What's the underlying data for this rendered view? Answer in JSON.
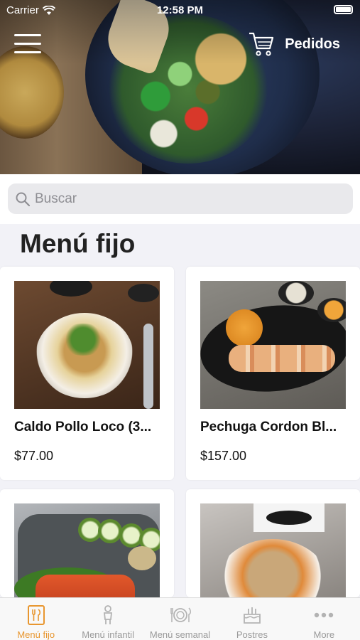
{
  "status_bar": {
    "carrier": "Carrier",
    "time": "12:58 PM"
  },
  "header": {
    "orders_label": "Pedidos"
  },
  "search": {
    "placeholder": "Buscar"
  },
  "section": {
    "title": "Menú fijo"
  },
  "products": [
    {
      "name": "Caldo Pollo Loco (3...",
      "price": "$77.00",
      "photo": "soup"
    },
    {
      "name": "Pechuga Cordon Bl...",
      "price": "$157.00",
      "photo": "chicken"
    },
    {
      "name": "",
      "price": "",
      "photo": "fish"
    },
    {
      "name": "",
      "price": "",
      "photo": "rice"
    }
  ],
  "tabs": [
    {
      "label": "Menú fijo",
      "icon": "menu-card-icon",
      "active": true
    },
    {
      "label": "Menú infantil",
      "icon": "child-icon",
      "active": false
    },
    {
      "label": "Menú semanal",
      "icon": "cutlery-plate-icon",
      "active": false
    },
    {
      "label": "Postres",
      "icon": "cake-icon",
      "active": false
    },
    {
      "label": "More",
      "icon": "more-dots-icon",
      "active": false
    }
  ],
  "colors": {
    "accent": "#e8962f",
    "inactive_tab": "#9a9a9a",
    "background": "#f2f2f7"
  }
}
